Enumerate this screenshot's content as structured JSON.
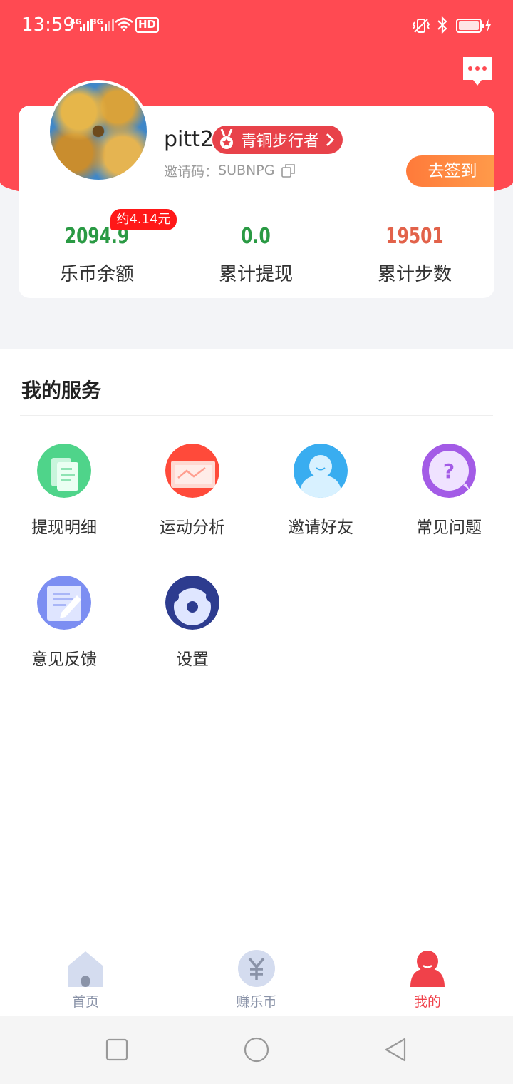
{
  "status_bar": {
    "time": "13:59",
    "sim1": "4G",
    "sim2": "3G",
    "hd": "HD"
  },
  "profile": {
    "username": "pitt2",
    "level_badge": "青铜步行者",
    "invite_label": "邀请码：",
    "invite_code": "SUBNPG",
    "checkin_button": "去签到"
  },
  "stats": {
    "approx_badge": "约4.14元",
    "items": [
      {
        "value": "2094.9",
        "label": "乐币余额",
        "color": "#2a9a44"
      },
      {
        "value": "0.0",
        "label": "累计提现",
        "color": "#2a9a44"
      },
      {
        "value": "19501",
        "label": "累计步数",
        "color": "#e2624a"
      }
    ]
  },
  "services": {
    "title": "我的服务",
    "items": [
      {
        "label": "提现明细",
        "icon": "document-icon"
      },
      {
        "label": "运动分析",
        "icon": "chart-icon"
      },
      {
        "label": "邀请好友",
        "icon": "user-icon"
      },
      {
        "label": "常见问题",
        "icon": "question-icon"
      },
      {
        "label": "意见反馈",
        "icon": "edit-note-icon"
      },
      {
        "label": "设置",
        "icon": "gear-icon"
      }
    ]
  },
  "bottom_nav": {
    "items": [
      {
        "label": "首页",
        "icon": "home-icon",
        "active": false
      },
      {
        "label": "赚乐币",
        "icon": "yen-coin-icon",
        "active": false
      },
      {
        "label": "我的",
        "icon": "profile-icon",
        "active": true
      }
    ],
    "active_color": "#f0414a",
    "inactive_color": "#8a93a8"
  },
  "colors": {
    "brand_red": "#ff4a52",
    "checkin_orange": "#ff7a3a"
  }
}
